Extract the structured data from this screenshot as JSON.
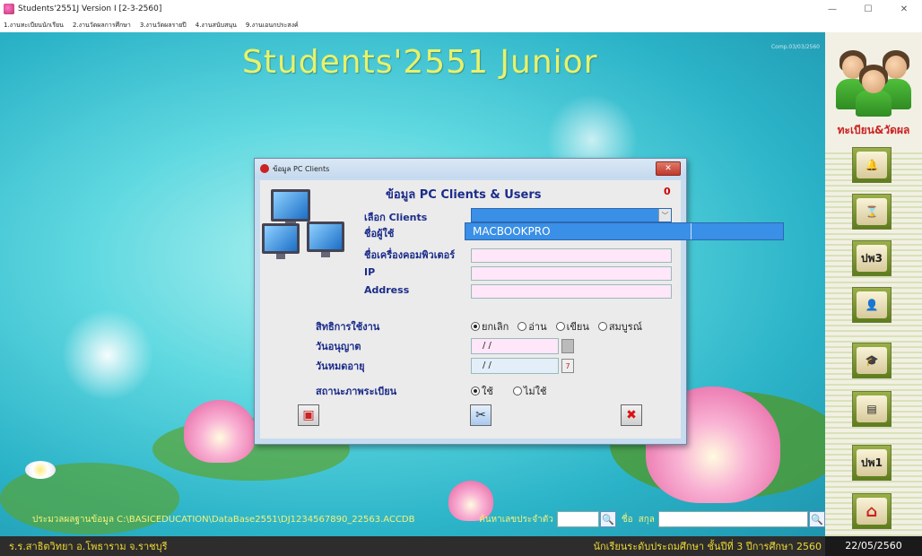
{
  "window": {
    "title": "Students'2551J Version I [2-3-2560]",
    "minimize": "—",
    "maximize": "☐",
    "close": "✕"
  },
  "menu": {
    "items": [
      "1.งานทะเบียนนักเรียน",
      "2.งานวัดผลการศึกษา",
      "3.งานวัดผลรายปี",
      "4.งานสนับสนุน",
      "9.งานเอนกประสงค์"
    ]
  },
  "main": {
    "app_title": "Students'2551 Junior",
    "comp_date": "Comp.03/03/2560",
    "db_path": "ประมวลผลฐานข้อมูล C:\\BASICEDUCATION\\DataBase2551\\DJ1234567890_22563.ACCDB",
    "search_id_label": "ค้นหาเลขประจำตัว",
    "name_label": "ชื่อ",
    "surname_label": "สกุล",
    "search_icon": "🔍"
  },
  "sidebar": {
    "reg_label": "ทะเบียน&วัดผล",
    "buttons": [
      {
        "name": "bell-icon",
        "text": "🔔"
      },
      {
        "name": "hourglass-icon",
        "text": "⌛"
      },
      {
        "name": "pw3-icon",
        "text": "ปพ3"
      },
      {
        "name": "student-icon",
        "text": "👤"
      },
      {
        "name": "graduate-icon",
        "text": "🎓"
      },
      {
        "name": "record-icon",
        "text": "▤"
      },
      {
        "name": "pw1-icon",
        "text": "ปพ1"
      },
      {
        "name": "home-icon",
        "text": "⌂"
      }
    ]
  },
  "status": {
    "school": "ร.ร.สาธิตวิทยา อ.โพธาราม จ.ราชบุรี",
    "level": "นักเรียนระดับประถมศึกษา ชั้นปีที่ 3 ปีการศึกษา 2560",
    "date": "22/05/2560"
  },
  "dialog": {
    "title": "ข้อมูล PC Clients",
    "close": "✕",
    "heading": "ข้อมูล PC Clients & Users",
    "count": "0",
    "label_select_clients": "เลือก Clients",
    "label_username": "ชื่อผู้ใช้",
    "label_computer_name": "ชื่อเครื่องคอมพิวเตอร์",
    "label_ip": "IP",
    "label_address": "Address",
    "dropdown_option": "MACBOOKPRO",
    "label_rights": "สิทธิการใช้งาน",
    "rights": [
      {
        "label": "ยกเลิก",
        "checked": true
      },
      {
        "label": "อ่าน",
        "checked": false
      },
      {
        "label": "เขียน",
        "checked": false
      },
      {
        "label": "สมบูรณ์",
        "checked": false
      }
    ],
    "label_allow_date": "วันอนุญาต",
    "label_expire_date": "วันหมดอายุ",
    "allow_date": "/ /",
    "expire_date": "/ /",
    "label_reg_status": "สถานะภาพระเบียน",
    "status_options": [
      {
        "label": "ใช้",
        "checked": true
      },
      {
        "label": "ไม่ใช้",
        "checked": false
      }
    ],
    "calendar_icon": "7"
  }
}
